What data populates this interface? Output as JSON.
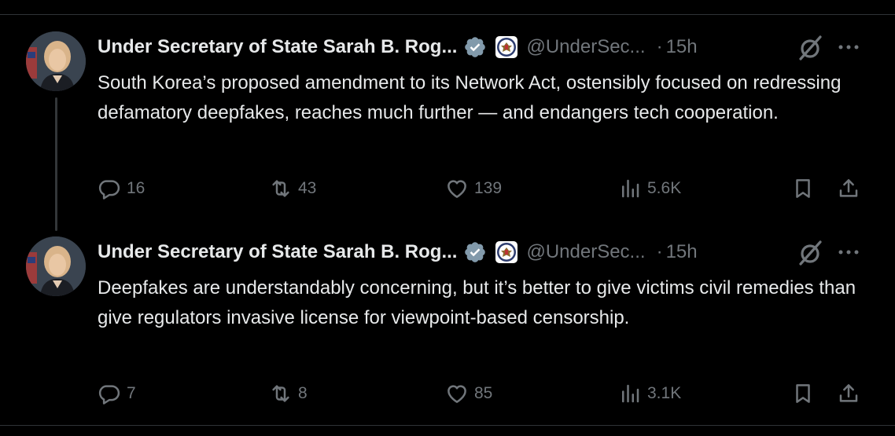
{
  "tweets": [
    {
      "author_name": "Under Secretary of State Sarah B. Rog...",
      "handle": "@UnderSec...",
      "separator": "·",
      "time": "15h",
      "text": "South Korea’s proposed amendment to its Network Act, ostensibly focused on redressing defamatory deepfakes, reaches much further — and endangers tech cooperation.",
      "replies": "16",
      "reposts": "43",
      "likes": "139",
      "views": "5.6K"
    },
    {
      "author_name": "Under Secretary of State Sarah B. Rog...",
      "handle": "@UnderSec...",
      "separator": "·",
      "time": "15h",
      "text": "Deepfakes are understandably concerning,  but it’s better to give victims civil remedies than give regulators invasive license for viewpoint-based censorship.",
      "replies": "7",
      "reposts": "8",
      "likes": "85",
      "views": "3.1K"
    }
  ],
  "colors": {
    "background": "#000000",
    "text_primary": "#e7e9ea",
    "text_secondary": "#71767b",
    "verified_badge": "#829aab",
    "divider": "#2f3336"
  },
  "icons": [
    "verified-badge-icon",
    "state-dept-seal-icon",
    "grok-icon",
    "more-icon",
    "reply-icon",
    "repost-icon",
    "like-icon",
    "views-icon",
    "bookmark-icon",
    "share-icon"
  ]
}
